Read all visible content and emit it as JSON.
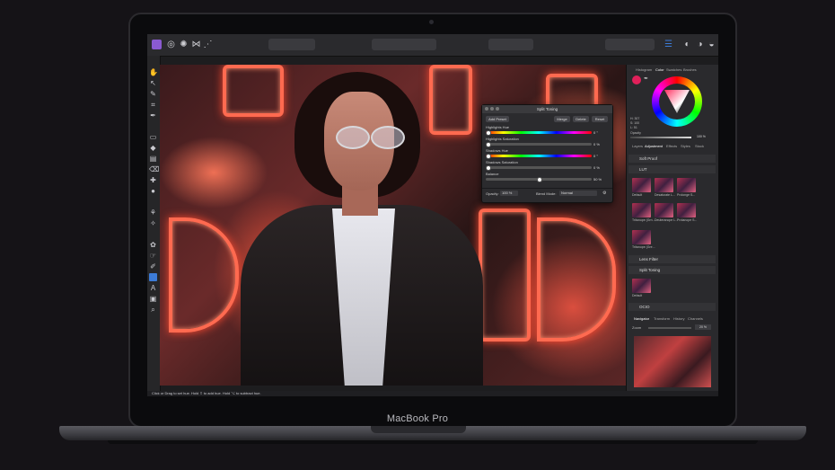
{
  "laptop": {
    "brand": "MacBook Pro"
  },
  "split_toning": {
    "title": "Split Toning",
    "buttons": {
      "add_preset": "Add Preset",
      "merge": "Merge",
      "delete": "Delete",
      "reset": "Reset"
    },
    "sliders": [
      {
        "label": "Highlights Hue",
        "value": "0 °"
      },
      {
        "label": "Highlights Saturation",
        "value": "0 %"
      },
      {
        "label": "Shadows Hue",
        "value": "0 °"
      },
      {
        "label": "Shadows Saturation",
        "value": "0 %"
      },
      {
        "label": "Balance",
        "value": "50 %"
      }
    ],
    "opacity_label": "Opacity:",
    "opacity_value": "100 %",
    "blend_label": "Blend Mode:",
    "blend_value": "Normal"
  },
  "panel": {
    "tabs_top": [
      "Histogram",
      "Color",
      "Swatches",
      "Brushes"
    ],
    "color_values": [
      "H: 307",
      "S: 100",
      "L: 51"
    ],
    "opacity_label": "Opacity",
    "opacity_value": "100 %",
    "tabs_mid": [
      "Layers",
      "Adjustment",
      "Effects",
      "Styles",
      "Stock"
    ],
    "rows": [
      "Soft Proof",
      "LUT",
      "Lens Filter",
      "Split Toning",
      "OCIO"
    ],
    "thumb_labels": [
      "Default",
      "Desaturate L...",
      "Prolonge S...",
      "Tritanope (Grn...",
      "Deuteranope L...",
      "Protanope S...",
      "Tritanope (Gre...",
      "Default"
    ],
    "tabs_bottom": [
      "Navigator",
      "Transform",
      "History",
      "Channels"
    ],
    "zoom_label": "Zoom",
    "zoom_value": "20 %"
  },
  "status": {
    "text": "Click or Drag to set hue. Hold ⇧ to add hue. Hold ⌥ to subtract hue."
  },
  "colors": {
    "accent": "#3c7bd6",
    "neon": "#ff6a50",
    "screen_bg": "#1d1d1f"
  }
}
